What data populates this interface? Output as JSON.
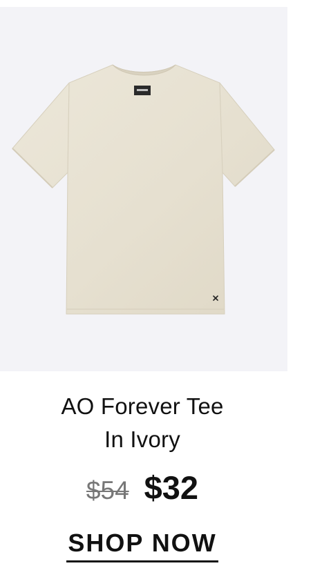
{
  "product": {
    "image_alt": "AO Forever Tee In Ivory",
    "title_line1": "AO Forever Tee",
    "title_line2": "In Ivory",
    "original_price": "$54",
    "sale_price": "$32",
    "cta_label": "SHOP NOW"
  },
  "colors": {
    "image_background": "#f3f3f7",
    "tee_color": "#e7e1d2",
    "text": "#111111",
    "strikethrough_price": "#777777"
  },
  "icons": {
    "brand_label": "brand-label-icon",
    "embroidered_x": "x-logo-icon"
  }
}
